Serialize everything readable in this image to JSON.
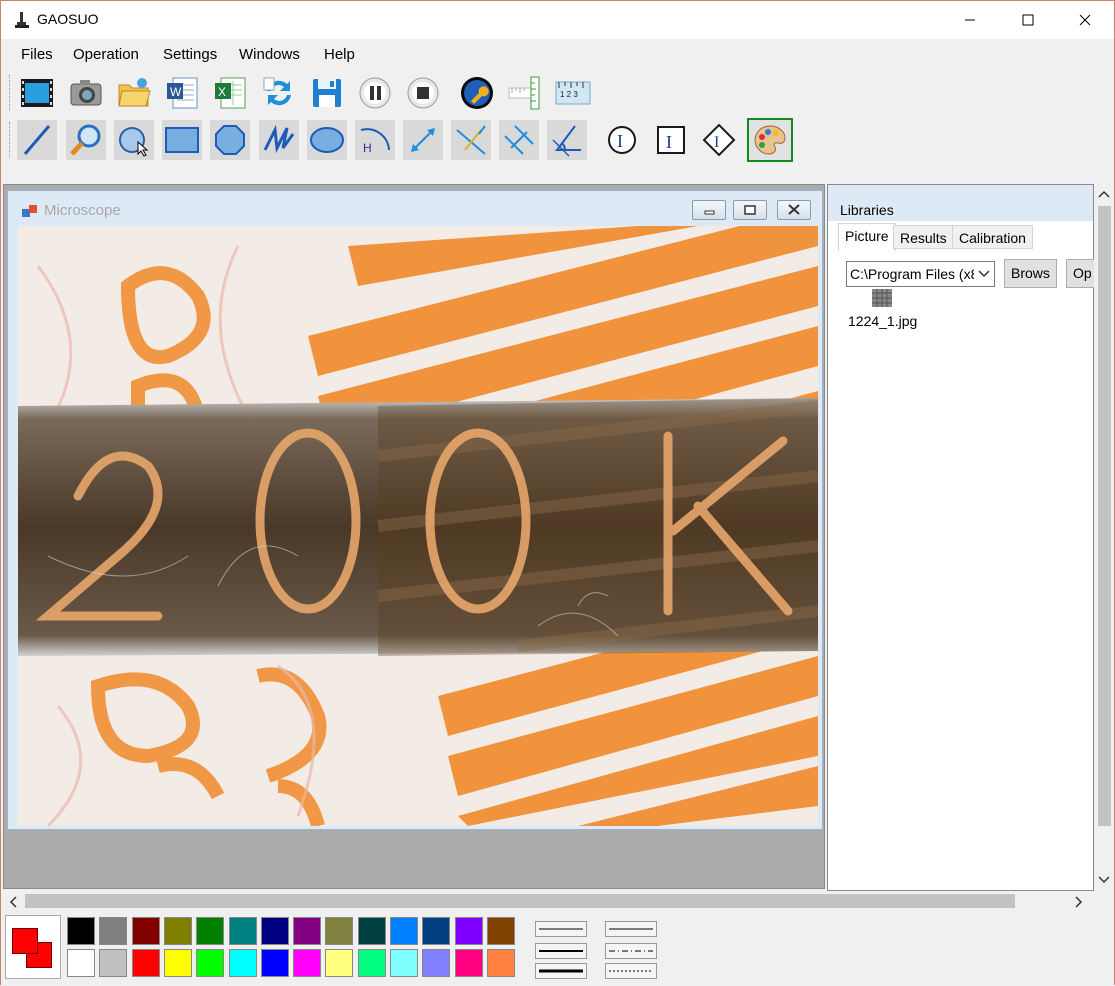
{
  "app": {
    "title": "GAOSUO"
  },
  "menu": [
    "Files",
    "Operation",
    "Settings",
    "Windows",
    "Help"
  ],
  "toolbar1": [
    "record-video-icon",
    "camera-icon",
    "open-folder-icon",
    "word-export-icon",
    "excel-export-icon",
    "refresh-icon",
    "save-icon",
    "pause-icon",
    "stop-icon",
    "wrench-icon",
    "vertical-ruler-icon",
    "horizontal-ruler-icon"
  ],
  "toolbar2": [
    "line-tool-icon",
    "magnifier-icon",
    "circle-select-icon",
    "rectangle-tool-icon",
    "polygon-tool-icon",
    "polyline-tool-icon",
    "ellipse-tool-icon",
    "arc-height-icon",
    "distance-icon",
    "perpendicular-icon",
    "parallel-icon",
    "angle-icon",
    "text-circle-icon",
    "text-box-icon",
    "text-diamond-icon",
    "palette-icon"
  ],
  "child_window": {
    "title": "Microscope"
  },
  "libraries": {
    "title": "Libraries",
    "tabs": [
      "Picture",
      "Results",
      "Calibration"
    ],
    "active_tab": "Picture",
    "path": "C:\\Program Files (x8",
    "browse_label": "Brows",
    "open_label": "Op",
    "file": "1224_1.jpg"
  },
  "colors": {
    "foreground": "#ff0000",
    "background": "#ff0000",
    "palette_row1": [
      "#000000",
      "#808080",
      "#800000",
      "#808000",
      "#008000",
      "#008080",
      "#000080",
      "#800080",
      "#808040",
      "#004040",
      "#0080ff",
      "#004080",
      "#8000ff",
      "#804000"
    ],
    "palette_row2": [
      "#ffffff",
      "#c0c0c0",
      "#ff0000",
      "#ffff00",
      "#00ff00",
      "#00ffff",
      "#0000ff",
      "#ff00ff",
      "#ffff80",
      "#00ff80",
      "#80ffff",
      "#8080ff",
      "#ff0080",
      "#ff8040"
    ]
  }
}
